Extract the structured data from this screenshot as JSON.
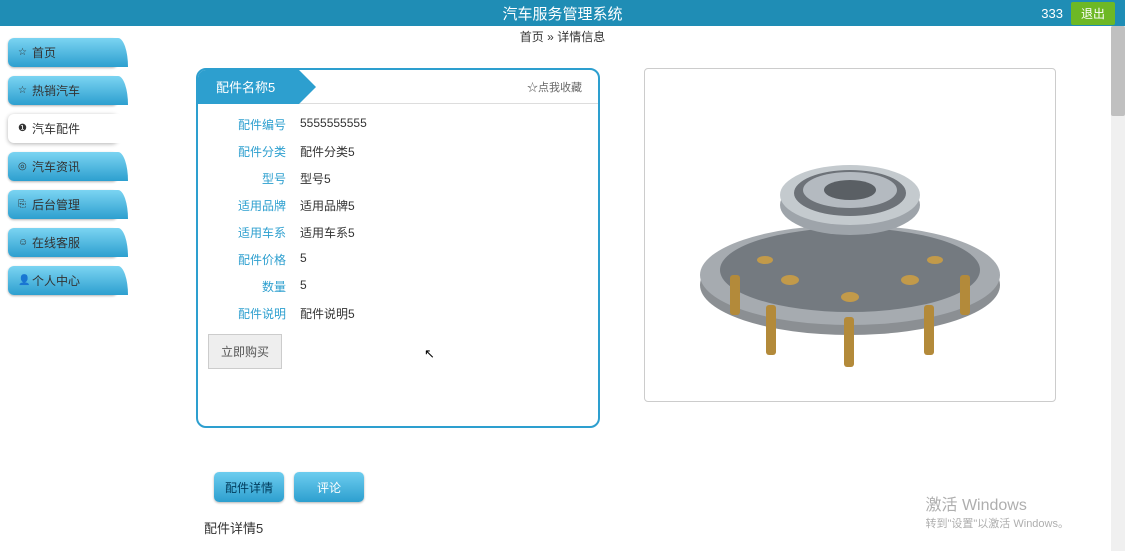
{
  "header": {
    "title": "汽车服务管理系统",
    "user": "333",
    "logout": "退出"
  },
  "breadcrumb": {
    "home": "首页",
    "sep": "»",
    "current": "详情信息"
  },
  "sidebar": {
    "items": [
      {
        "icon": "☆",
        "label": "首页"
      },
      {
        "icon": "☆",
        "label": "热销汽车"
      },
      {
        "icon": "❶",
        "label": "汽车配件"
      },
      {
        "icon": "◎",
        "label": "汽车资讯"
      },
      {
        "icon": "⎘",
        "label": "后台管理"
      },
      {
        "icon": "☺",
        "label": "在线客服"
      },
      {
        "icon": "👤",
        "label": "个人中心"
      }
    ]
  },
  "card": {
    "title": "配件名称5",
    "favorite": "☆点我收藏",
    "rows": [
      {
        "label": "配件编号",
        "value": "5555555555"
      },
      {
        "label": "配件分类",
        "value": "配件分类5"
      },
      {
        "label": "型号",
        "value": "型号5"
      },
      {
        "label": "适用品牌",
        "value": "适用品牌5"
      },
      {
        "label": "适用车系",
        "value": "适用车系5"
      },
      {
        "label": "配件价格",
        "value": "5"
      },
      {
        "label": "数量",
        "value": "5"
      },
      {
        "label": "配件说明",
        "value": "配件说明5"
      }
    ],
    "buy": "立即购买"
  },
  "tabs": {
    "detail": "配件详情",
    "comment": "评论"
  },
  "section_heading": "配件详情5",
  "watermark": {
    "line1": "激活 Windows",
    "line2": "转到\"设置\"以激活 Windows。"
  }
}
